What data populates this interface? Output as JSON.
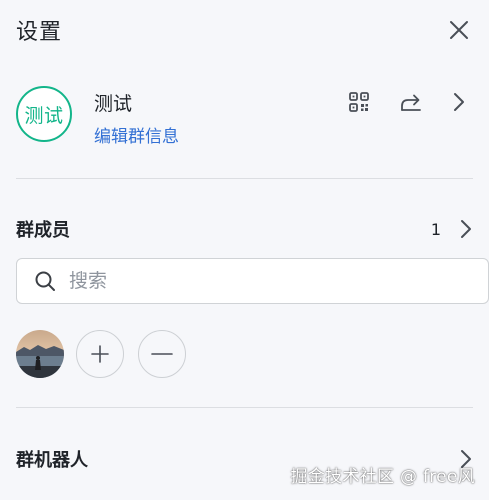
{
  "header": {
    "title": "设置",
    "close_icon": "close-icon"
  },
  "group": {
    "avatar_text": "测试",
    "name": "测试",
    "edit_label": "编辑群信息",
    "accent_color": "#13b58a",
    "link_color": "#3370d4",
    "icons": [
      "qrcode-icon",
      "share-icon",
      "chevron-right-icon"
    ]
  },
  "members": {
    "title": "群成员",
    "count": "1",
    "search_placeholder": "搜索",
    "search_value": "",
    "add_icon": "plus-icon",
    "remove_icon": "minus-icon"
  },
  "bots": {
    "title": "群机器人"
  },
  "watermark": "掘金技术社区 @ free风"
}
